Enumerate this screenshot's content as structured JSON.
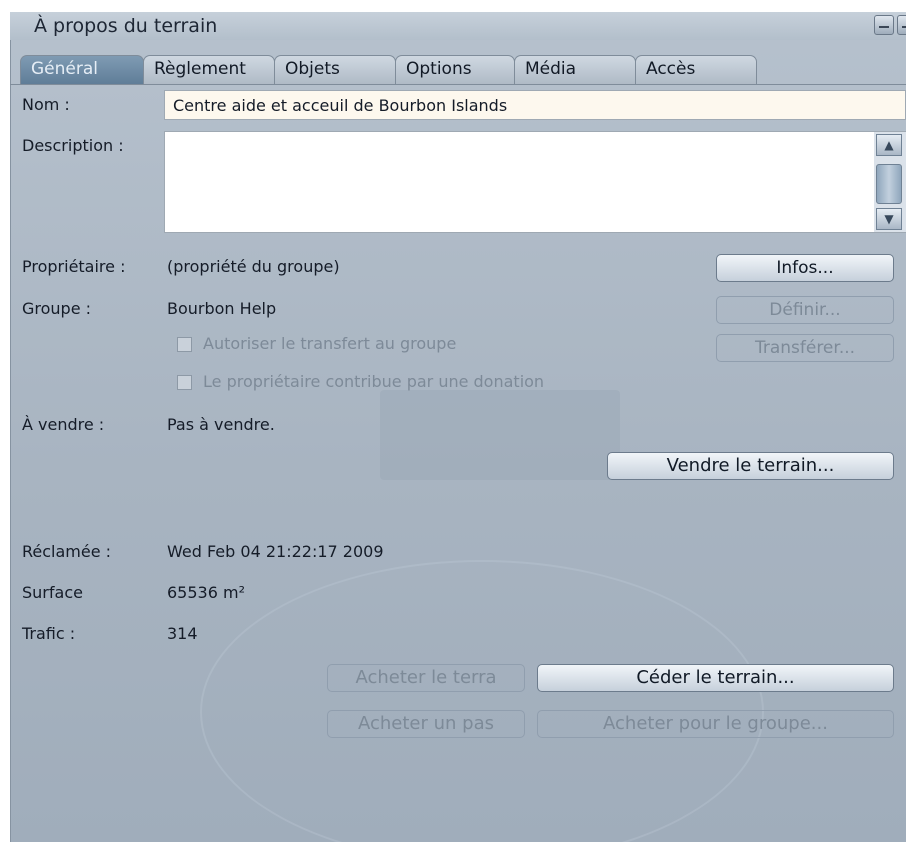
{
  "window": {
    "title": "À propos du terrain"
  },
  "tabs": [
    {
      "label": "Général",
      "active": true
    },
    {
      "label": "Règlement",
      "active": false
    },
    {
      "label": "Objets",
      "active": false
    },
    {
      "label": "Options",
      "active": false
    },
    {
      "label": "Média",
      "active": false
    },
    {
      "label": "Accès",
      "active": false
    }
  ],
  "general": {
    "name_label": "Nom :",
    "name_value": "Centre aide et acceuil de Bourbon Islands",
    "description_label": "Description :",
    "description_value": "",
    "owner_label": "Propriétaire :",
    "owner_value": "(propriété du groupe)",
    "group_label": "Groupe :",
    "group_value": "Bourbon Help",
    "allow_deed_label": "Autoriser le transfert au groupe",
    "owner_contrib_label": "Le propriétaire contribue par une donation",
    "for_sale_label": "À vendre :",
    "for_sale_value": "Pas à vendre.",
    "claimed_label": "Réclamée :",
    "claimed_value": "Wed Feb 04 21:22:17 2009",
    "area_label": "Surface",
    "area_value": "65536 m²",
    "traffic_label": "Trafic :",
    "traffic_value": "314"
  },
  "buttons": {
    "info": "Infos...",
    "set": "Définir...",
    "deed": "Transférer...",
    "sell": "Vendre le terrain...",
    "buy_land": "Acheter le terra",
    "release": "Céder le terrain...",
    "buy_pass": "Acheter un pas",
    "buy_for_group": "Acheter pour le groupe..."
  }
}
